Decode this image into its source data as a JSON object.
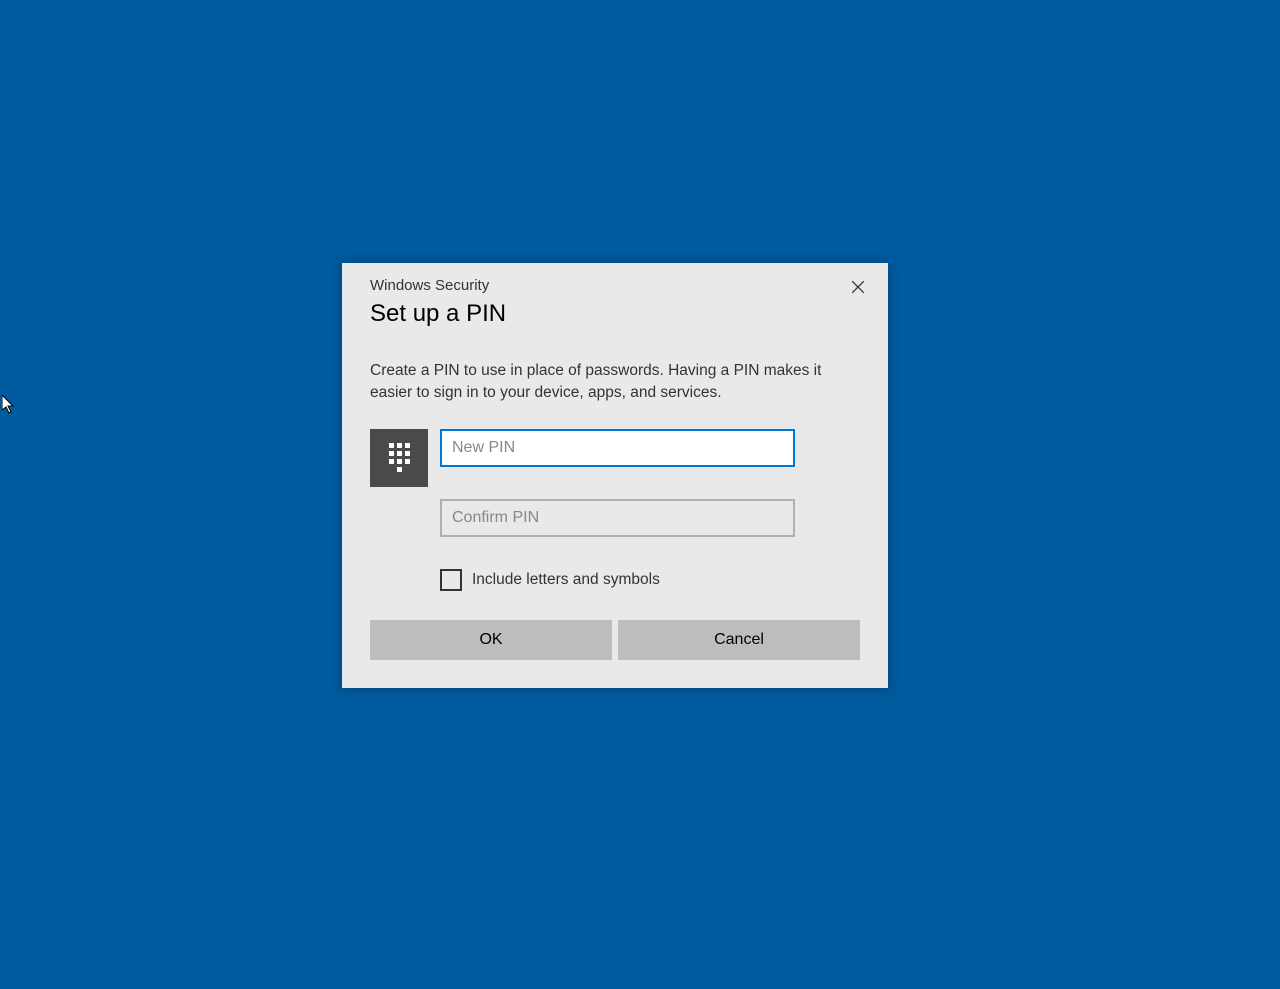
{
  "dialog": {
    "small_title": "Windows Security",
    "title": "Set up a PIN",
    "description": "Create a PIN to use in place of passwords. Having a PIN makes it easier to sign in to your device, apps, and services.",
    "new_pin_placeholder": "New PIN",
    "new_pin_value": "",
    "confirm_pin_placeholder": "Confirm PIN",
    "confirm_pin_value": "",
    "checkbox_label": "Include letters and symbols",
    "checkbox_checked": false,
    "ok_label": "OK",
    "cancel_label": "Cancel"
  }
}
